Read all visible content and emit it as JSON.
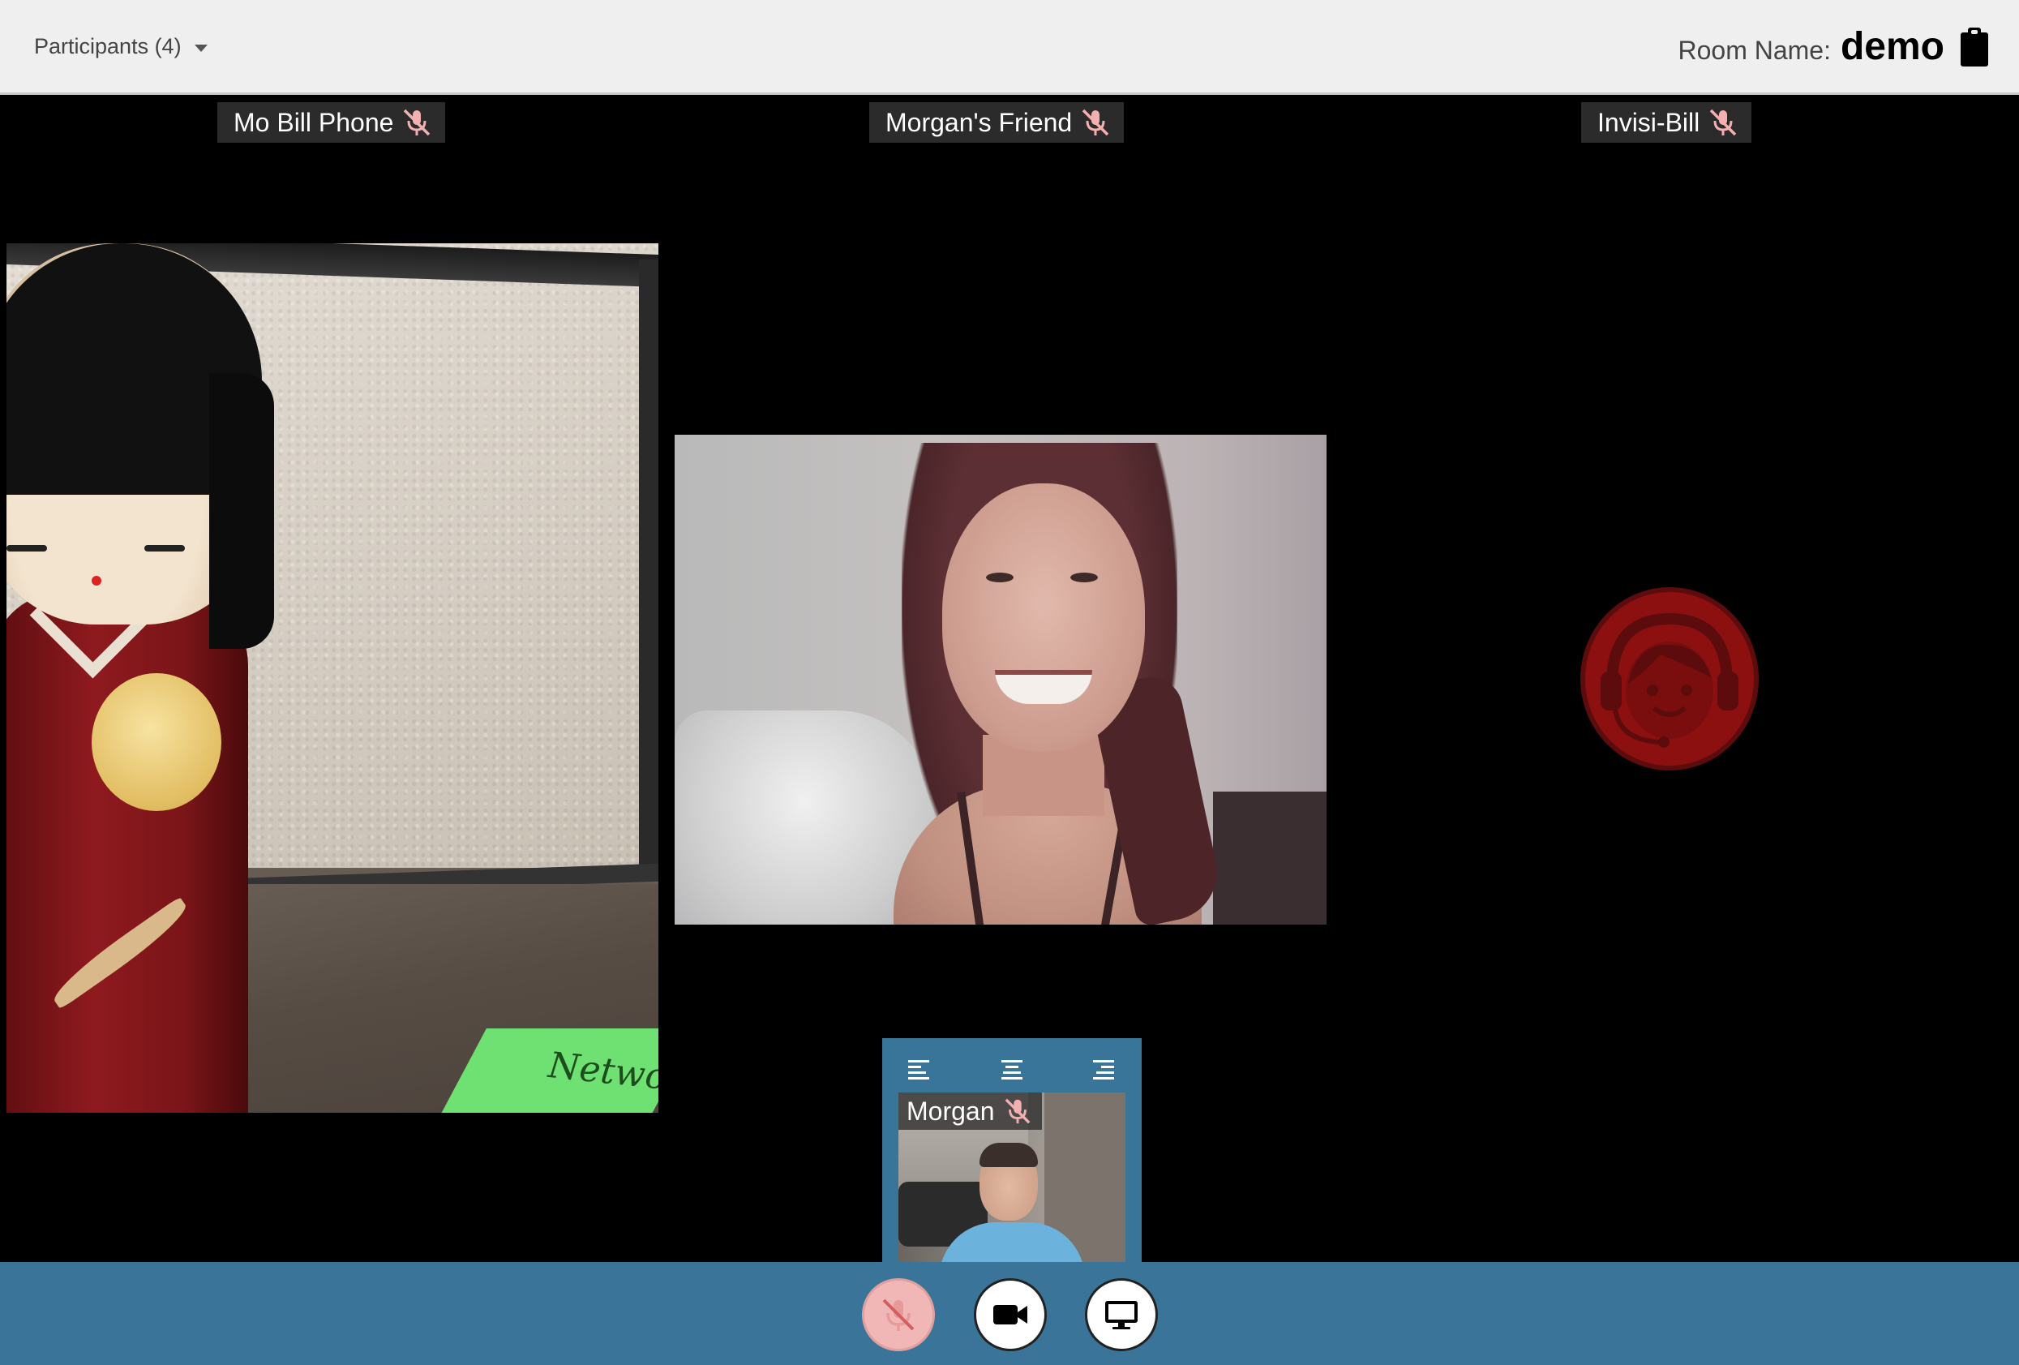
{
  "header": {
    "participants_label": "Participants (4)",
    "room_label": "Room Name:",
    "room_name": "demo"
  },
  "participants": [
    {
      "name": "Mo Bill Phone",
      "muted": true
    },
    {
      "name": "Morgan's Friend",
      "muted": true
    },
    {
      "name": "Invisi-Bill",
      "muted": true
    }
  ],
  "local": {
    "name": "Morgan",
    "muted": true,
    "align_icons": [
      "align-left-icon",
      "align-center-icon",
      "align-right-icon"
    ]
  },
  "tile1": {
    "card_text": "Network"
  },
  "toolbar": {
    "buttons": [
      "mute-mic-icon",
      "camera-icon",
      "screen-share-icon"
    ]
  },
  "colors": {
    "header_bg": "#efefef",
    "toolbar_bg": "#3a7499",
    "muted_button_bg": "#f1b7b7",
    "avatar_red": "#9a0f0f"
  }
}
